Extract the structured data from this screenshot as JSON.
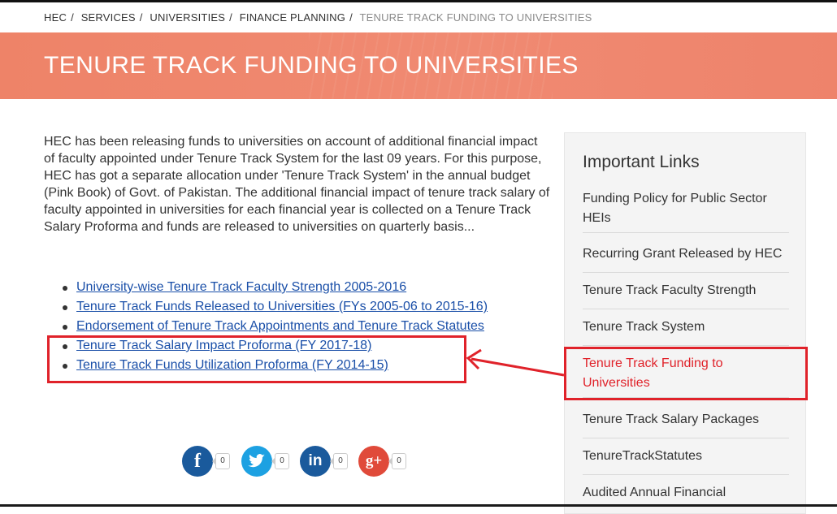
{
  "breadcrumb": {
    "items": [
      "HEC",
      "SERVICES",
      "UNIVERSITIES",
      "FINANCE PLANNING"
    ],
    "separator": "/",
    "current": "TENURE TRACK FUNDING TO UNIVERSITIES"
  },
  "banner": {
    "title": "TENURE TRACK FUNDING TO UNIVERSITIES",
    "color": "#ef856d"
  },
  "intro": {
    "text": "HEC has been releasing funds to universities on account of additional financial impact of faculty appointed under Tenure Track System for the last 09 years. For this purpose, HEC has got a separate allocation under 'Tenure Track System' in the annual budget (Pink Book) of Govt. of Pakistan. The additional financial impact of tenure track salary of faculty appointed in universities for each financial year is collected on a Tenure Track Salary Proforma and funds are released to universities on quarterly basis..."
  },
  "links": [
    "University-wise Tenure Track Faculty Strength 2005-2016",
    "Tenure Track Funds Released to Universities (FYs 2005-06 to 2015-16)",
    "Endorsement of Tenure Track Appointments and Tenure Track Statutes",
    "Tenure Track Salary Impact Proforma (FY 2017-18)",
    "Tenure Track Funds Utilization Proforma (FY 2014-15)"
  ],
  "share": {
    "facebook": {
      "glyph": "f",
      "count": "0",
      "color": "#1a5a9c",
      "icon": "facebook-icon"
    },
    "twitter": {
      "glyph": "t",
      "count": "0",
      "color": "#1da1e2",
      "icon": "twitter-icon"
    },
    "linkedin": {
      "glyph": "in",
      "count": "0",
      "color": "#1a5a9c",
      "icon": "linkedin-icon"
    },
    "googleplus": {
      "glyph": "g+",
      "count": "0",
      "color": "#e04a3a",
      "icon": "google-plus-icon"
    }
  },
  "sidebar": {
    "title": "Important Links",
    "items": [
      "Funding Policy for Public Sector HEIs",
      "Recurring Grant Released by HEC",
      "Tenure Track Faculty Strength",
      "Tenure Track System",
      "Tenure Track Funding to Universities",
      "Tenure Track Salary Packages",
      "TenureTrackStatutes",
      "Audited Annual Financial"
    ],
    "active_index": 4
  },
  "annotation": {
    "color": "#e0222a"
  }
}
